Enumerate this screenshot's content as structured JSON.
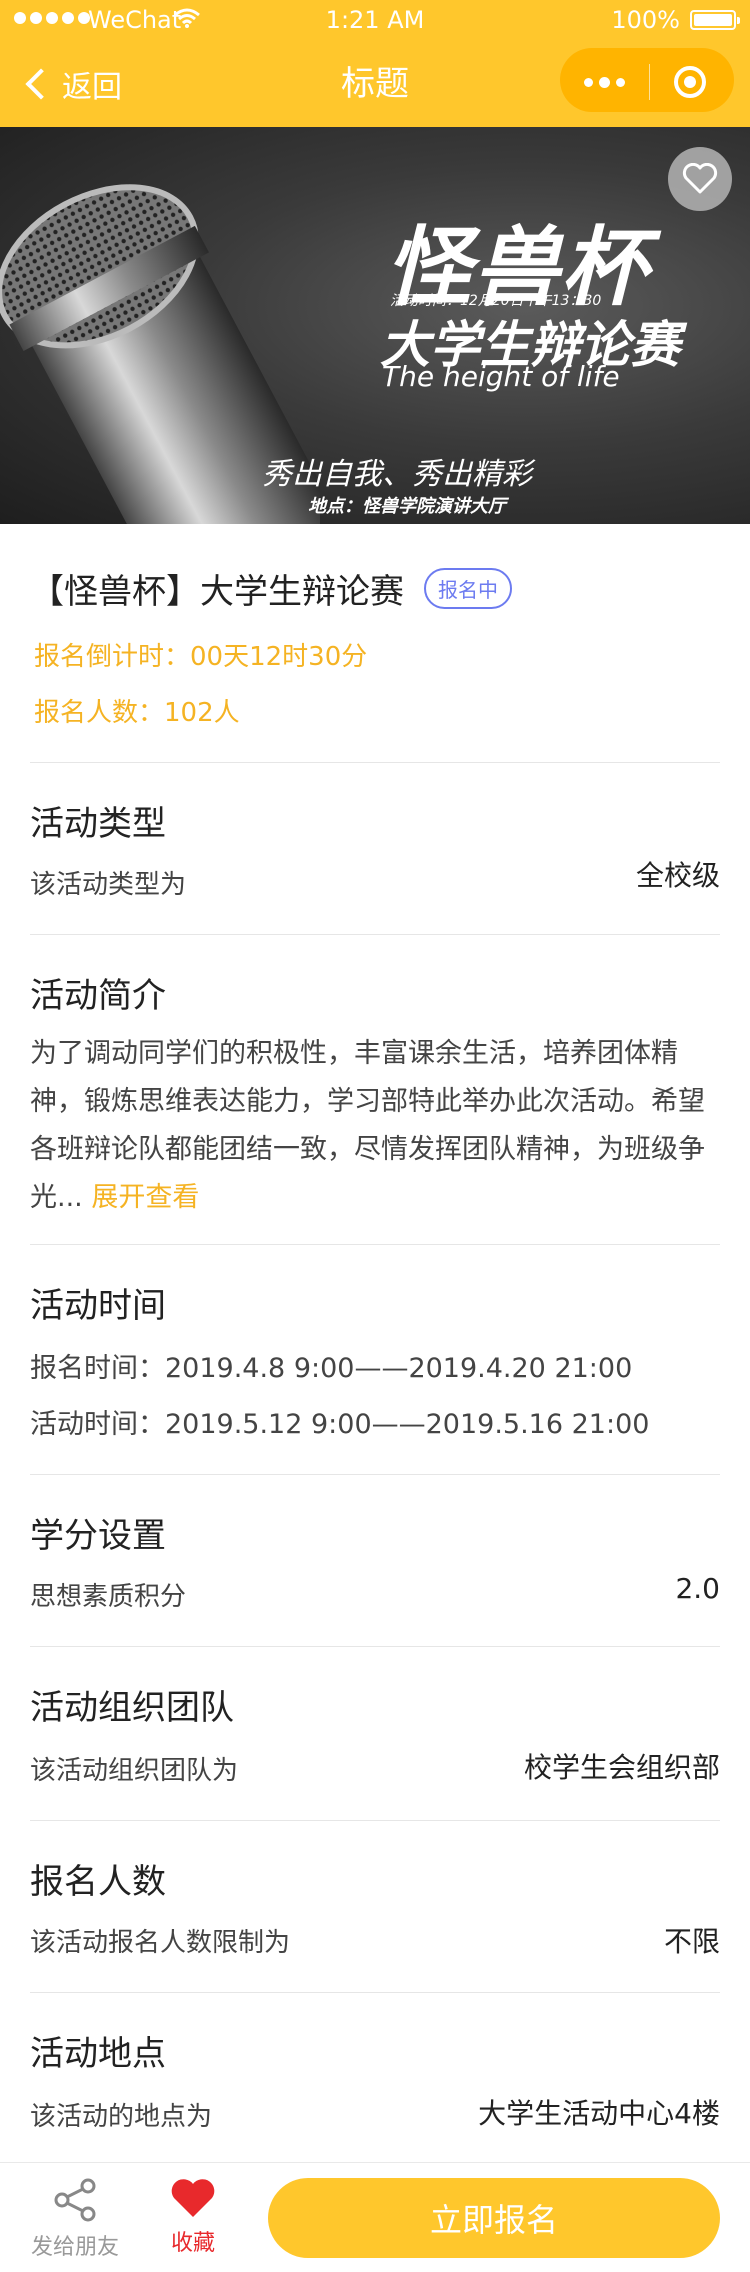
{
  "status_bar": {
    "carrier": "WeChat",
    "time": "1:21 AM",
    "battery": "100%"
  },
  "nav": {
    "back_label": "返回",
    "title": "标题"
  },
  "banner": {
    "title_big": "怪兽杯",
    "event_time": "活动时间：12月20日下午13：30",
    "title_sub": "大学生辩论赛",
    "english": "The height of life",
    "slogan": "秀出自我、秀出精彩",
    "location": "地点：怪兽学院演讲大厅"
  },
  "event": {
    "title": "【怪兽杯】大学生辩论赛",
    "status_tag": "报名中",
    "countdown": "报名倒计时：00天12时30分",
    "signup_count": "报名人数：102人"
  },
  "sections": {
    "type": {
      "title": "活动类型",
      "label": "该活动类型为",
      "value": "全校级"
    },
    "intro": {
      "title": "活动简介",
      "text": "为了调动同学们的积极性，丰富课余生活，培养团体精神，锻炼思维表达能力，学习部特此举办此次活动。希望各班辩论队都能团结一致，尽情发挥团队精神，为班级争光...",
      "more": "展开查看"
    },
    "time": {
      "title": "活动时间",
      "signup": "报名时间：2019.4.8 9:00——2019.4.20 21:00",
      "activity": "活动时间：2019.5.12 9:00——2019.5.16 21:00"
    },
    "credit": {
      "title": "学分设置",
      "label": "思想素质积分",
      "value": "2.0"
    },
    "team": {
      "title": "活动组织团队",
      "label": "该活动组织团队为",
      "value": "校学生会组织部"
    },
    "limit": {
      "title": "报名人数",
      "label": "该活动报名人数限制为",
      "value": "不限"
    },
    "place": {
      "title": "活动地点",
      "label": "该活动的地点为",
      "value": "大学生活动中心4楼"
    }
  },
  "bottom_bar": {
    "share_label": "发给朋友",
    "collect_label": "收藏",
    "cta_label": "立即报名"
  },
  "colors": {
    "accent": "#FFC72C",
    "highlight": "#F5B323",
    "tag": "#6C7BF0",
    "favorite": "#E8292C"
  },
  "icons": [
    "signal-icon",
    "wifi-icon",
    "battery-icon",
    "back-chevron-icon",
    "more-icon",
    "close-target-icon",
    "heart-outline-icon",
    "share-icon",
    "heart-filled-icon"
  ]
}
